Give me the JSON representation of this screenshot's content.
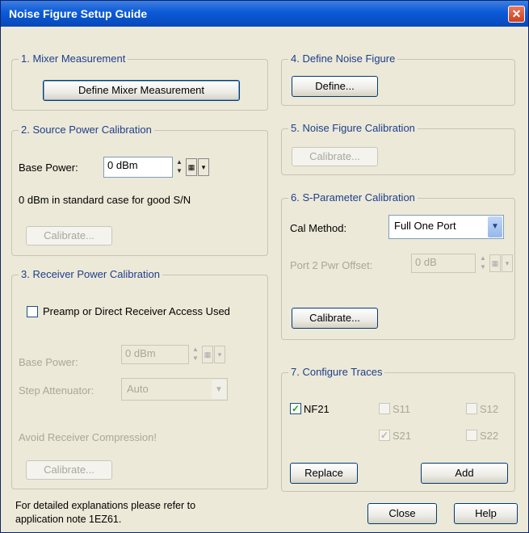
{
  "window": {
    "title": "Noise Figure Setup Guide",
    "close_glyph": "✕"
  },
  "mixer": {
    "legend": "1. Mixer Measurement",
    "button": "Define Mixer Measurement"
  },
  "source": {
    "legend": "2. Source Power Calibration",
    "base_power_label": "Base Power:",
    "base_power_value": "0 dBm",
    "hint": "0 dBm in standard case for good S/N",
    "calibrate": "Calibrate..."
  },
  "receiver": {
    "legend": "3. Receiver Power Calibration",
    "preamp_label": "Preamp or Direct Receiver Access Used",
    "preamp_checked": false,
    "base_power_label": "Base Power:",
    "base_power_value": "0 dBm",
    "step_att_label": "Step Attenuator:",
    "step_att_value": "Auto",
    "warning": "Avoid Receiver Compression!",
    "calibrate": "Calibrate..."
  },
  "noise_define": {
    "legend": "4. Define Noise Figure",
    "button": "Define..."
  },
  "nf_cal": {
    "legend": "5. Noise Figure Calibration",
    "button": "Calibrate..."
  },
  "sparam": {
    "legend": "6. S-Parameter Calibration",
    "cal_method_label": "Cal Method:",
    "cal_method_value": "Full One Port",
    "port2_label": "Port 2 Pwr Offset:",
    "port2_value": "0 dB",
    "calibrate": "Calibrate..."
  },
  "traces": {
    "legend": "7. Configure Traces",
    "items": [
      {
        "label": "NF21",
        "checked": true,
        "enabled": true
      },
      {
        "label": "S11",
        "checked": false,
        "enabled": false
      },
      {
        "label": "S12",
        "checked": false,
        "enabled": false
      },
      {
        "label": "S21",
        "checked": true,
        "enabled": false
      },
      {
        "label": "S22",
        "checked": false,
        "enabled": false
      }
    ],
    "replace": "Replace",
    "add": "Add"
  },
  "footer": {
    "note_line1": "For detailed explanations please refer to",
    "note_line2": "application note 1EZ61.",
    "close": "Close",
    "help": "Help"
  },
  "icons": {
    "spin_up": "▲",
    "spin_down": "▼",
    "keypad": "▦",
    "menu": "▾",
    "dropdown": "▼",
    "check": "✓"
  }
}
